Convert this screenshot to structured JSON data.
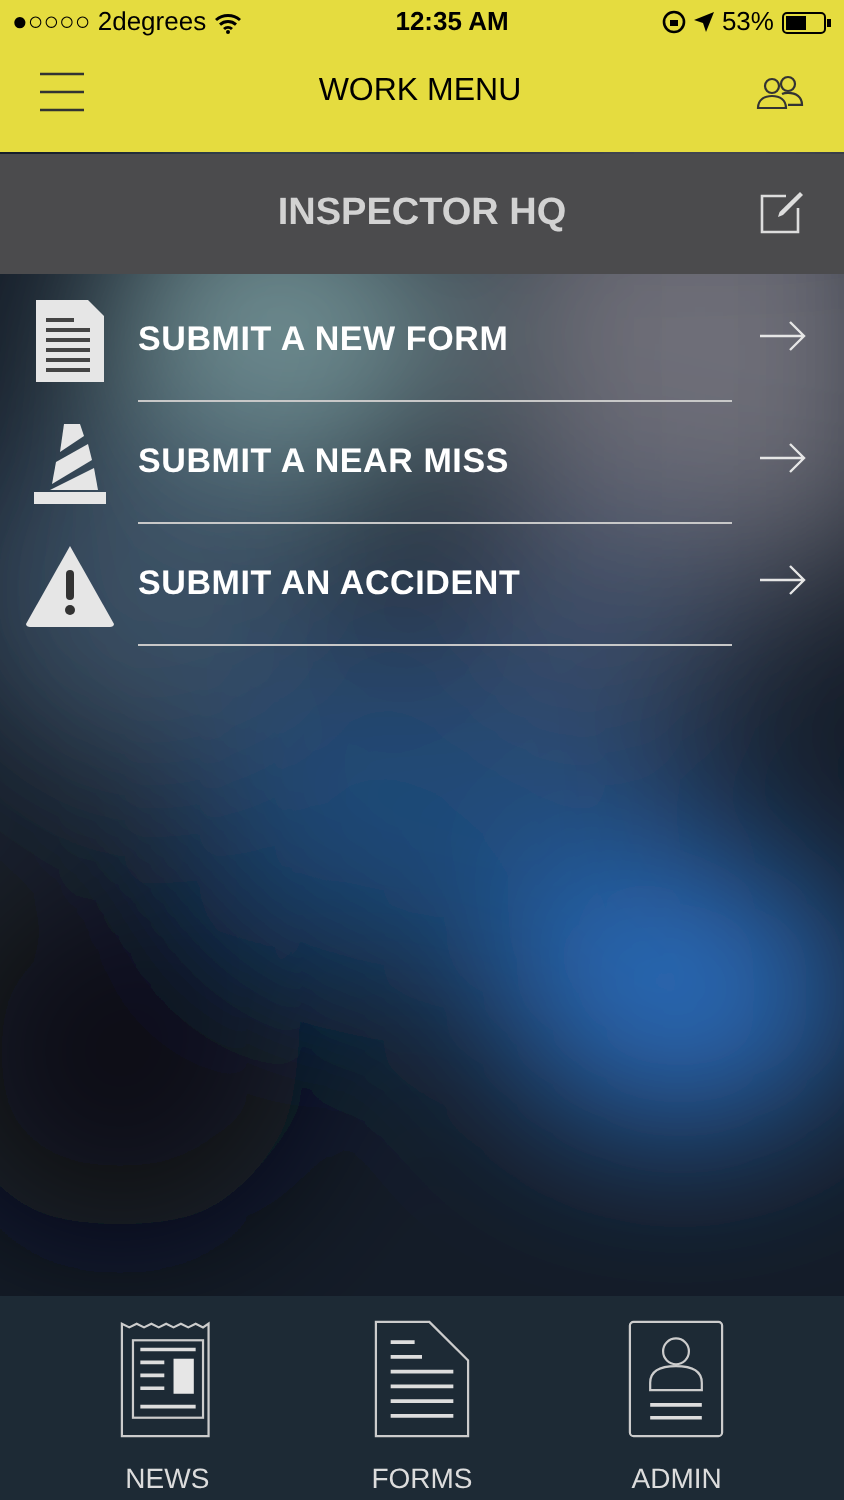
{
  "status_bar": {
    "carrier": "●○○○○ 2degrees",
    "time": "12:35 AM",
    "battery": "53%"
  },
  "header": {
    "title": "WORK MENU"
  },
  "subheader": {
    "title": "INSPECTOR HQ"
  },
  "menu_items": [
    {
      "label": "SUBMIT A NEW FORM",
      "kind": "form"
    },
    {
      "label": "SUBMIT A NEAR MISS",
      "kind": "cone"
    },
    {
      "label": "SUBMIT AN ACCIDENT",
      "kind": "warning"
    }
  ],
  "tab_bar": [
    {
      "label": "NEWS",
      "kind": "news"
    },
    {
      "label": "FORMS",
      "kind": "forms"
    },
    {
      "label": "ADMIN",
      "kind": "admin"
    }
  ]
}
